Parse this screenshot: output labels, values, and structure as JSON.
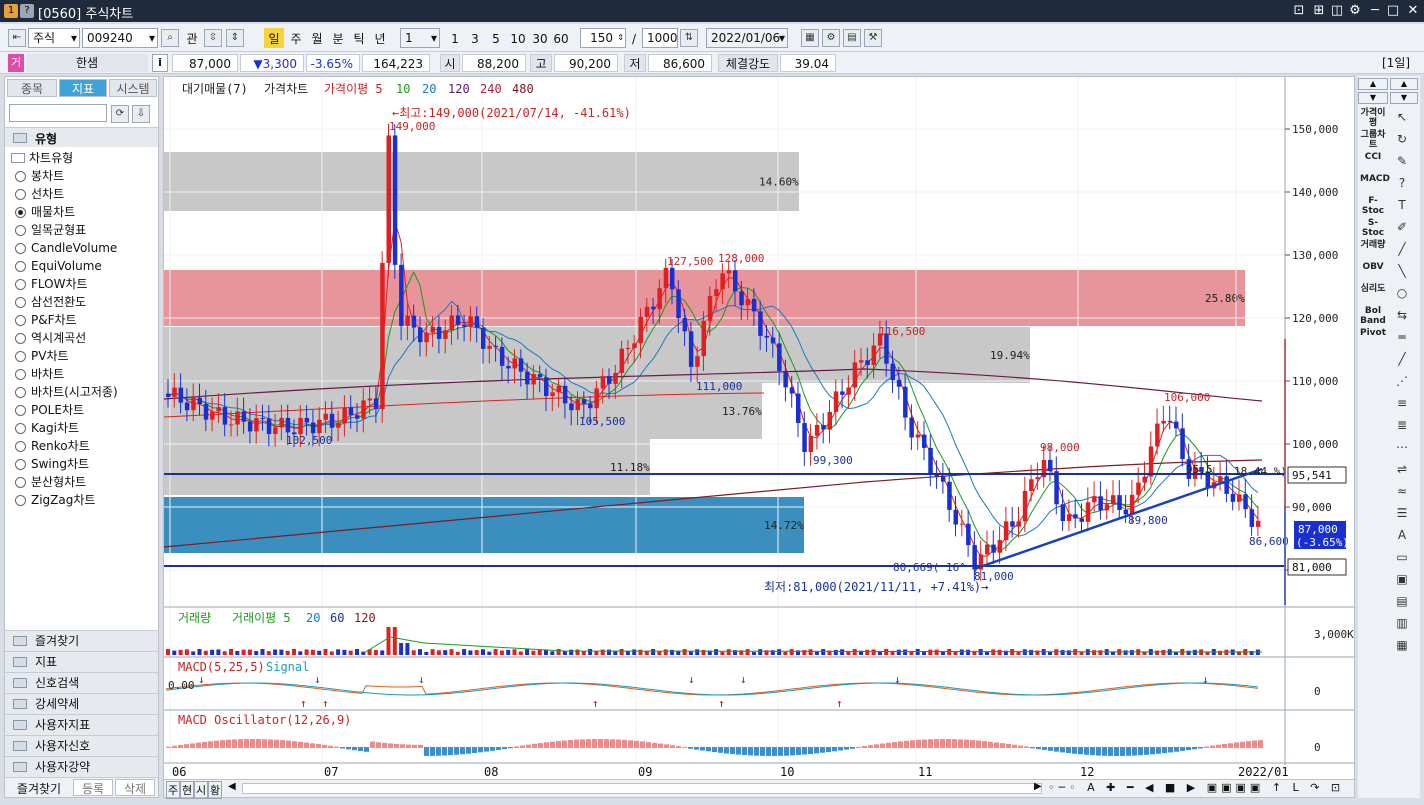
{
  "window": {
    "title": "[0560] 주식차트",
    "icons": [
      "1",
      "?"
    ]
  },
  "toolbar": {
    "market": "주식",
    "code": "009240",
    "btn_gwan": "관",
    "periods": [
      "일",
      "주",
      "월",
      "분",
      "틱",
      "년"
    ],
    "interval_value": "1",
    "quick": [
      "1",
      "3",
      "5",
      "10",
      "30",
      "60"
    ],
    "count": "150",
    "slash": "/",
    "total": "1000",
    "date": "2022/01/06"
  },
  "quote": {
    "name_tag": "거",
    "name": "한샘",
    "info_btn": "i",
    "price": "87,000",
    "change": "▼3,300",
    "rate": "-3.65%",
    "volume": "164,223",
    "open_label": "시",
    "open": "88,200",
    "high_label": "고",
    "high": "90,200",
    "low_label": "저",
    "low": "86,600",
    "strength_label": "체결강도",
    "strength": "39.04",
    "period_badge": "[1일]"
  },
  "left": {
    "tabs": [
      "종목",
      "지표",
      "시스템"
    ],
    "section_title": "유형",
    "tree_root": "차트유형",
    "chart_types": [
      "봉차트",
      "선차트",
      "매물차트",
      "일목균형표",
      "CandleVolume",
      "EquiVolume",
      "FLOW차트",
      "삼선전환도",
      "P&F차트",
      "역시계곡선",
      "PV차트",
      "바차트",
      "바차트(시고저종)",
      "POLE차트",
      "Kagi차트",
      "Renko차트",
      "Swing차트",
      "분산형차트",
      "ZigZag차트"
    ],
    "selected": "매물차트",
    "sections": [
      "즐겨찾기",
      "지표",
      "신호검색",
      "강세약세",
      "사용자지표",
      "사용자신호",
      "사용자강약"
    ],
    "bottom_tabs": [
      "즐겨찾기",
      "등록",
      "삭제"
    ]
  },
  "right": {
    "indicators": [
      "가격이평",
      "그룹차트",
      "CCI",
      "MACD",
      "F-Stoc",
      "S-Stoc",
      "거래량",
      "OBV",
      "심리도",
      "Bol Band",
      "Pivot"
    ]
  },
  "chart": {
    "main_legend": [
      "대기매물(7)",
      "가격차트",
      "가격이평 5",
      "10",
      "20",
      "120",
      "240",
      "480"
    ],
    "price_axis": [
      "150,000",
      "140,000",
      "130,000",
      "120,000",
      "110,000",
      "100,000",
      "90,000",
      "80,000"
    ],
    "volume_profile": [
      {
        "label": "14.60%",
        "color": "#c8c8c8"
      },
      {
        "label": "25.80%",
        "color": "#e8949b"
      },
      {
        "label": "19.94%",
        "color": "#c8c8c8"
      },
      {
        "label": "13.76%",
        "color": "#c8c8c8"
      },
      {
        "label": "11.18%",
        "color": "#c8c8c8"
      },
      {
        "label": "14.72%",
        "color": "#3b8fbf"
      }
    ],
    "annotations": {
      "max": "←최고:149,000(2021/07/14, -41.61%)",
      "max_price": "149,000",
      "min": "최저:81,000(2021/11/11, +7.41%)→",
      "min_price": "81,000",
      "p102500": "102,500",
      "p105500": "105,500",
      "p127500": "127,500",
      "p128000": "128,000",
      "p111000": "111,000",
      "p116500": "116,500",
      "p99300": "99,300",
      "p98000": "98,000",
      "p106000": "106,000",
      "p89800": "89,800",
      "p86600": "86,600",
      "fib1": "80,669( 16^ )",
      "fib2": "18.44 %)",
      "fib3": "95,5"
    },
    "badges": {
      "last_price": "87,000",
      "last_rate": "(-3.65%)",
      "line1": "95,541",
      "line2": "81,000"
    },
    "volume_legend": [
      "거래량",
      "거래이평 5",
      "20",
      "60",
      "120"
    ],
    "volume_axis": "3,000K",
    "macd_legend": [
      "MACD(5,25,5)",
      "Signal"
    ],
    "macd_left": "0.00",
    "macd_axis": "0",
    "osc_legend": [
      "MACD Oscillator(12,26,9)"
    ],
    "osc_axis": "0",
    "x_axis": [
      "06",
      "07",
      "08",
      "09",
      "10",
      "11",
      "12",
      "2022/01"
    ],
    "bottom_left": [
      "주",
      "현",
      "시",
      "황"
    ]
  },
  "colors": {
    "up": "#e02020",
    "down": "#1a2fd0",
    "accent": "#3fa3d9",
    "title_bg": "#1f2a3c"
  }
}
